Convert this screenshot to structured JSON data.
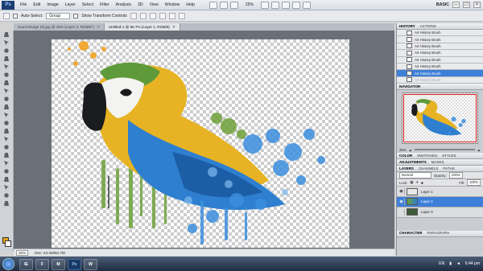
{
  "menubar": {
    "logo": "Ps",
    "items": [
      "File",
      "Edit",
      "Image",
      "Layer",
      "Select",
      "Filter",
      "Analysis",
      "3D",
      "View",
      "Window",
      "Help"
    ],
    "zoom": "25%",
    "workspace": "BASIC"
  },
  "options": {
    "auto_select_label": "Auto-Select:",
    "auto_select_value": "Group",
    "show_transform_label": "Show Transform Controls"
  },
  "tabs": [
    {
      "label": "sourceimage (8).jpg @ 25% (Layer 2, RGB/8*)",
      "active": false
    },
    {
      "label": "Untitled-1 @ 66.7% (Layer 1, RGB/8)",
      "active": true
    }
  ],
  "statusbar": {
    "zoom": "25%",
    "doc": "Doc: 23.4M/62.7M"
  },
  "history": {
    "tabs": [
      "HISTORY",
      "ACTIONS"
    ],
    "items": [
      {
        "label": "Art History Brush",
        "state": "normal"
      },
      {
        "label": "Art History Brush",
        "state": "normal"
      },
      {
        "label": "Art History Brush",
        "state": "normal"
      },
      {
        "label": "Art History Brush",
        "state": "normal"
      },
      {
        "label": "Art History Brush",
        "state": "normal"
      },
      {
        "label": "Art History Brush",
        "state": "normal"
      },
      {
        "label": "Art History Brush",
        "state": "selected"
      },
      {
        "label": "Art History Brush",
        "state": "dim"
      }
    ]
  },
  "navigator": {
    "title": "NAVIGATOR",
    "zoom": "25%"
  },
  "color_panel": {
    "tabs": [
      "COLOR",
      "SWATCHES",
      "STYLES"
    ]
  },
  "adjust_panel": {
    "tabs": [
      "ADJUSTMENTS",
      "MASKS"
    ]
  },
  "layers": {
    "tabs": [
      "LAYERS",
      "CHANNELS",
      "PATHS"
    ],
    "blend": "Normal",
    "opacity_label": "Opacity:",
    "opacity": "100%",
    "lock_label": "Lock:",
    "fill_label": "Fill:",
    "fill": "100%",
    "items": [
      {
        "name": "Layer 1",
        "selected": false
      },
      {
        "name": "Layer 2",
        "selected": true
      },
      {
        "name": "Layer 0",
        "selected": false
      }
    ]
  },
  "character_panel": {
    "tabs": [
      "CHARACTER",
      "PARAGRAPH"
    ]
  },
  "taskbar": {
    "apps": [
      "IE",
      "F",
      "M",
      "Ps",
      "W"
    ],
    "lang": "EN",
    "time": "6:44 pm"
  },
  "colors": {
    "accent": "#3d7fd9",
    "foreground": "#e8a314",
    "taskbar": "#1e2c40"
  }
}
